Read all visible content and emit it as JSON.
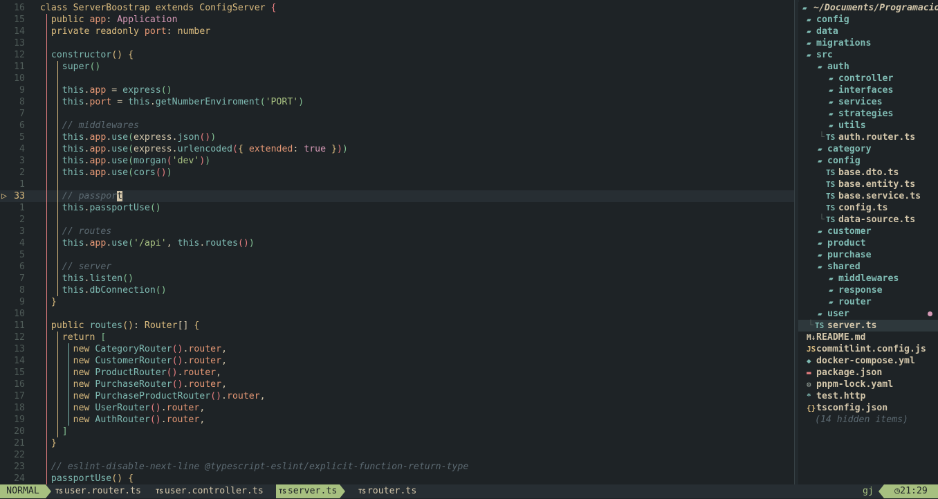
{
  "editor": {
    "sign": "▷",
    "lines": [
      {
        "n": "16",
        "g": 0,
        "html": "<span class=\"kw2\">class</span> <span class=\"type\">ServerBoostrap</span> <span class=\"kw2\">extends</span> <span class=\"type\">ConfigServer</span> <span class=\"p1\">{</span>"
      },
      {
        "n": "15",
        "g": 1,
        "html": "  <span class=\"kw2\">public</span> <span class=\"kw\">app</span><span class=\"tx\">:</span> <span class=\"cls\">Application</span>"
      },
      {
        "n": "14",
        "g": 1,
        "html": "  <span class=\"kw2\">private</span> <span class=\"kw2\">readonly</span> <span class=\"kw\">port</span><span class=\"tx\">:</span> <span class=\"type\">number</span>"
      },
      {
        "n": "13",
        "g": 1,
        "html": ""
      },
      {
        "n": "12",
        "g": 1,
        "html": "  <span class=\"pr\">constructor</span><span class=\"p2\">()</span> <span class=\"p2\">{</span>"
      },
      {
        "n": "11",
        "g": 2,
        "html": "    <span class=\"this\">super</span><span class=\"p3\">()</span>"
      },
      {
        "n": "10",
        "g": 2,
        "html": ""
      },
      {
        "n": "9",
        "g": 2,
        "html": "    <span class=\"this\">this</span>.<span class=\"kw\">app</span> = <span class=\"pr\">express</span><span class=\"p3\">()</span>"
      },
      {
        "n": "8",
        "g": 2,
        "html": "    <span class=\"this\">this</span>.<span class=\"kw\">port</span> = <span class=\"this\">this</span>.<span class=\"pr\">getNumberEnviroment</span><span class=\"p3\">(</span><span class=\"str\">'PORT'</span><span class=\"p3\">)</span>"
      },
      {
        "n": "7",
        "g": 2,
        "html": ""
      },
      {
        "n": "6",
        "g": 2,
        "html": "    <span class=\"cm\">// middlewares</span>"
      },
      {
        "n": "5",
        "g": 2,
        "html": "    <span class=\"this\">this</span>.<span class=\"kw\">app</span>.<span class=\"pr\">use</span><span class=\"p3\">(</span><span class=\"tx\">express</span>.<span class=\"pr\">json</span><span class=\"p1\">()</span><span class=\"p3\">)</span>"
      },
      {
        "n": "4",
        "g": 2,
        "html": "    <span class=\"this\">this</span>.<span class=\"kw\">app</span>.<span class=\"pr\">use</span><span class=\"p3\">(</span><span class=\"tx\">express</span>.<span class=\"pr\">urlencoded</span><span class=\"p1\">(</span><span class=\"p2\">{</span> <span class=\"kw\">extended</span>: <span class=\"cls\">true</span> <span class=\"p2\">}</span><span class=\"p1\">)</span><span class=\"p3\">)</span>"
      },
      {
        "n": "3",
        "g": 2,
        "html": "    <span class=\"this\">this</span>.<span class=\"kw\">app</span>.<span class=\"pr\">use</span><span class=\"p3\">(</span><span class=\"pr\">morgan</span><span class=\"p1\">(</span><span class=\"str\">'dev'</span><span class=\"p1\">)</span><span class=\"p3\">)</span>"
      },
      {
        "n": "2",
        "g": 2,
        "html": "    <span class=\"this\">this</span>.<span class=\"kw\">app</span>.<span class=\"pr\">use</span><span class=\"p3\">(</span><span class=\"pr\">cors</span><span class=\"p1\">()</span><span class=\"p3\">)</span>"
      },
      {
        "n": "1",
        "g": 2,
        "html": ""
      },
      {
        "n": "33",
        "g": 2,
        "cur": true,
        "html": "    <span class=\"cm\">// passpor</span><span class=\"cursor\">t</span>"
      },
      {
        "n": "1",
        "g": 2,
        "html": "    <span class=\"this\">this</span>.<span class=\"pr\">passportUse</span><span class=\"p3\">()</span>"
      },
      {
        "n": "2",
        "g": 2,
        "html": ""
      },
      {
        "n": "3",
        "g": 2,
        "html": "    <span class=\"cm\">// routes</span>"
      },
      {
        "n": "4",
        "g": 2,
        "html": "    <span class=\"this\">this</span>.<span class=\"kw\">app</span>.<span class=\"pr\">use</span><span class=\"p3\">(</span><span class=\"str\">'/api'</span>, <span class=\"this\">this</span>.<span class=\"pr\">routes</span><span class=\"p1\">()</span><span class=\"p3\">)</span>"
      },
      {
        "n": "5",
        "g": 2,
        "html": ""
      },
      {
        "n": "6",
        "g": 2,
        "html": "    <span class=\"cm\">// server</span>"
      },
      {
        "n": "7",
        "g": 2,
        "html": "    <span class=\"this\">this</span>.<span class=\"pr\">listen</span><span class=\"p3\">()</span>"
      },
      {
        "n": "8",
        "g": 2,
        "html": "    <span class=\"this\">this</span>.<span class=\"pr\">dbConnection</span><span class=\"p3\">()</span>"
      },
      {
        "n": "9",
        "g": 1,
        "html": "  <span class=\"p2\">}</span>"
      },
      {
        "n": "10",
        "g": 1,
        "html": ""
      },
      {
        "n": "11",
        "g": 1,
        "html": "  <span class=\"kw2\">public</span> <span class=\"pr\">routes</span><span class=\"p2\">()</span><span class=\"tx\">:</span> <span class=\"type\">Router</span><span class=\"tx\">[]</span> <span class=\"p2\">{</span>"
      },
      {
        "n": "12",
        "g": 2,
        "html": "    <span class=\"kw2\">return</span> <span class=\"p3\">[</span>"
      },
      {
        "n": "13",
        "g": 3,
        "html": "      <span class=\"kw2\">new</span> <span class=\"pr\">CategoryRouter</span><span class=\"p1\">()</span>.<span class=\"kw\">router</span>,"
      },
      {
        "n": "14",
        "g": 3,
        "html": "      <span class=\"kw2\">new</span> <span class=\"pr\">CustomerRouter</span><span class=\"p1\">()</span>.<span class=\"kw\">router</span>,"
      },
      {
        "n": "15",
        "g": 3,
        "html": "      <span class=\"kw2\">new</span> <span class=\"pr\">ProductRouter</span><span class=\"p1\">()</span>.<span class=\"kw\">router</span>,"
      },
      {
        "n": "16",
        "g": 3,
        "html": "      <span class=\"kw2\">new</span> <span class=\"pr\">PurchaseRouter</span><span class=\"p1\">()</span>.<span class=\"kw\">router</span>,"
      },
      {
        "n": "17",
        "g": 3,
        "html": "      <span class=\"kw2\">new</span> <span class=\"pr\">PurchaseProductRouter</span><span class=\"p1\">()</span>.<span class=\"kw\">router</span>,"
      },
      {
        "n": "18",
        "g": 3,
        "html": "      <span class=\"kw2\">new</span> <span class=\"pr\">UserRouter</span><span class=\"p1\">()</span>.<span class=\"kw\">router</span>,"
      },
      {
        "n": "19",
        "g": 3,
        "html": "      <span class=\"kw2\">new</span> <span class=\"pr\">AuthRouter</span><span class=\"p1\">()</span>.<span class=\"kw\">router</span>,"
      },
      {
        "n": "20",
        "g": 2,
        "html": "    <span class=\"p3\">]</span>"
      },
      {
        "n": "21",
        "g": 1,
        "html": "  <span class=\"p2\">}</span>"
      },
      {
        "n": "22",
        "g": 1,
        "html": ""
      },
      {
        "n": "23",
        "g": 1,
        "html": "  <span class=\"cm\">// eslint-disable-next-line @typescript-eslint/explicit-function-return-type</span>"
      },
      {
        "n": "24",
        "g": 1,
        "html": "  <span class=\"pr\">passportUse</span><span class=\"p2\">()</span> <span class=\"p2\">{</span>"
      }
    ]
  },
  "tree": {
    "root": "~/Documents/Programacion",
    "items": [
      {
        "d": 1,
        "type": "folder",
        "label": "config"
      },
      {
        "d": 1,
        "type": "folder",
        "label": "data"
      },
      {
        "d": 1,
        "type": "folder",
        "label": "migrations"
      },
      {
        "d": 1,
        "type": "folder-open",
        "label": "src"
      },
      {
        "d": 2,
        "type": "folder-open",
        "label": "auth"
      },
      {
        "d": 3,
        "type": "folder",
        "label": "controller"
      },
      {
        "d": 3,
        "type": "folder",
        "label": "interfaces"
      },
      {
        "d": 3,
        "type": "folder",
        "label": "services"
      },
      {
        "d": 3,
        "type": "folder",
        "label": "strategies"
      },
      {
        "d": 3,
        "type": "folder",
        "label": "utils"
      },
      {
        "d": 3,
        "type": "ts",
        "last": true,
        "label": "auth.router.ts"
      },
      {
        "d": 2,
        "type": "folder",
        "label": "category"
      },
      {
        "d": 2,
        "type": "folder-open",
        "label": "config"
      },
      {
        "d": 3,
        "type": "ts",
        "label": "base.dto.ts"
      },
      {
        "d": 3,
        "type": "ts",
        "label": "base.entity.ts"
      },
      {
        "d": 3,
        "type": "ts",
        "label": "base.service.ts"
      },
      {
        "d": 3,
        "type": "ts",
        "label": "config.ts"
      },
      {
        "d": 3,
        "type": "ts",
        "last": true,
        "label": "data-source.ts"
      },
      {
        "d": 2,
        "type": "folder",
        "label": "customer"
      },
      {
        "d": 2,
        "type": "folder",
        "label": "product"
      },
      {
        "d": 2,
        "type": "folder",
        "label": "purchase"
      },
      {
        "d": 2,
        "type": "folder-open",
        "label": "shared"
      },
      {
        "d": 3,
        "type": "folder",
        "label": "middlewares"
      },
      {
        "d": 3,
        "type": "folder",
        "label": "response"
      },
      {
        "d": 3,
        "type": "folder",
        "label": "router"
      },
      {
        "d": 2,
        "type": "folder",
        "label": "user",
        "dot": true
      },
      {
        "d": 2,
        "type": "ts",
        "last": true,
        "active": true,
        "label": "server.ts"
      },
      {
        "d": 1,
        "type": "md",
        "label": "README.md"
      },
      {
        "d": 1,
        "type": "js",
        "label": "commitlint.config.js"
      },
      {
        "d": 1,
        "type": "docker",
        "label": "docker-compose.yml"
      },
      {
        "d": 1,
        "type": "npm",
        "label": "package.json"
      },
      {
        "d": 1,
        "type": "gear",
        "label": "pnpm-lock.yaml"
      },
      {
        "d": 1,
        "type": "star",
        "label": "test.http"
      },
      {
        "d": 1,
        "type": "json",
        "label": "tsconfig.json"
      },
      {
        "d": 1,
        "type": "hidden",
        "label": "(14 hidden items)"
      }
    ]
  },
  "status": {
    "mode": "NORMAL",
    "tabs": [
      {
        "label": "user.router.ts",
        "selected": false
      },
      {
        "label": "user.controller.ts",
        "selected": false
      },
      {
        "label": "server.ts",
        "selected": true
      },
      {
        "label": "router.ts",
        "selected": false
      }
    ],
    "keys": "gj",
    "time": "21:29"
  },
  "colors": {
    "accent": "#a7c080",
    "background": "#1e2326",
    "folder": "#7fbbb3",
    "modified": "#d699b6"
  }
}
